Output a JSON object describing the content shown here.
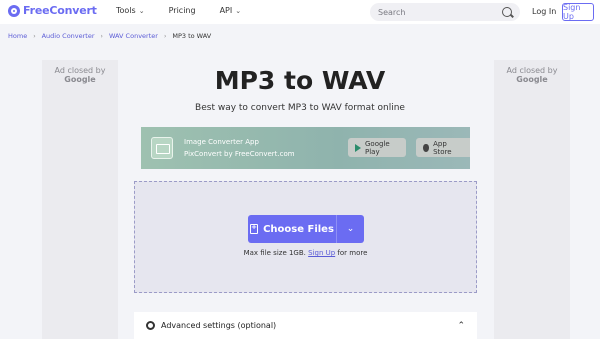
{
  "header": {
    "logo_text": "FreeConvert",
    "nav": [
      {
        "label": "Tools",
        "has_dropdown": true
      },
      {
        "label": "Pricing",
        "has_dropdown": false
      },
      {
        "label": "API",
        "has_dropdown": true
      }
    ],
    "search_placeholder": "Search",
    "login_label": "Log In",
    "signup_label": "Sign Up"
  },
  "breadcrumb": {
    "items": [
      "Home",
      "Audio Converter",
      "WAV Converter"
    ],
    "current": "MP3 to WAV"
  },
  "ads": {
    "line1": "Ad closed by",
    "line2": "Google"
  },
  "main": {
    "title": "MP3 to WAV",
    "subtitle": "Best way to convert MP3 to WAV format online"
  },
  "banner": {
    "title": "Image Converter App",
    "subtitle": "PixConvert by FreeConvert.com",
    "google_play_label": "Google Play",
    "app_store_label": "App Store"
  },
  "upload": {
    "choose_label": "Choose Files",
    "max_size_prefix": "Max file size 1GB.",
    "signup_link": "Sign Up",
    "max_size_suffix": "for more"
  },
  "advanced": {
    "label": "Advanced settings (optional)"
  },
  "colors": {
    "accent": "#6b6cf2",
    "page_bg": "#f3f4f8"
  }
}
